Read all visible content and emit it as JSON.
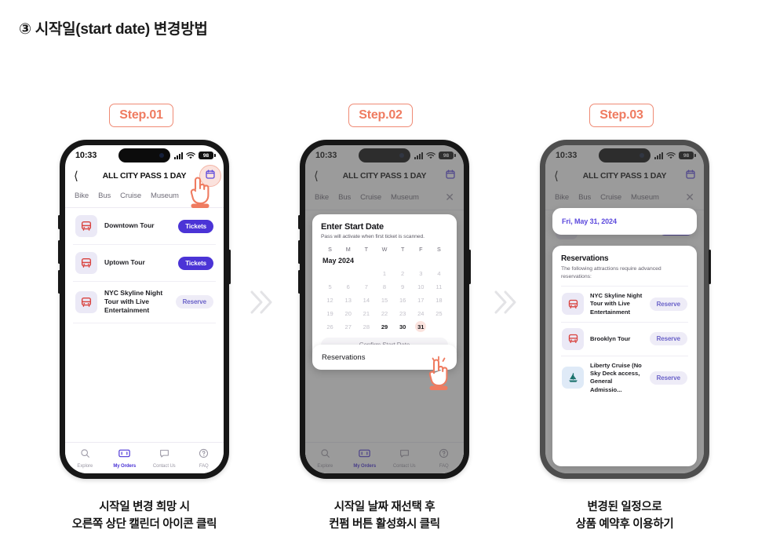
{
  "page": {
    "title": "③ 시작일(start date) 변경방법"
  },
  "steps": [
    {
      "badge": "Step.01",
      "caption_line1": "시작일 변경 희망 시",
      "caption_line2": "오른쪽 상단 캘린더 아이콘 클릭"
    },
    {
      "badge": "Step.02",
      "caption_line1": "시작일 날짜 재선택 후",
      "caption_line2": "컨펌 버튼 활성화시 클릭"
    },
    {
      "badge": "Step.03",
      "caption_line1": "변경된 일정으로",
      "caption_line2": "상품 예약후 이용하기"
    }
  ],
  "status_bar": {
    "time": "10:33",
    "battery": "98",
    "signal_icon": "cellular-bars-icon",
    "wifi_icon": "wifi-icon",
    "battery_icon": "battery-icon"
  },
  "nav": {
    "back_icon": "chevron-left-icon",
    "title": "ALL CITY PASS 1 DAY",
    "calendar_icon": "calendar-icon"
  },
  "category_tabs": {
    "items": [
      "Bike",
      "Bus",
      "Cruise",
      "Museum"
    ],
    "close_icon": "close-x-icon"
  },
  "step1": {
    "rows": [
      {
        "icon": "bus-icon",
        "title": "Downtown Tour",
        "action": "Tickets",
        "style": "solid"
      },
      {
        "icon": "bus-icon",
        "title": "Uptown Tour",
        "action": "Tickets",
        "style": "solid"
      },
      {
        "icon": "bus-icon",
        "title": "NYC Skyline Night Tour with Live Entertainment",
        "action": "Reserve",
        "style": "ghost"
      }
    ]
  },
  "step2": {
    "modal": {
      "title": "Enter Start Date",
      "subtitle": "Pass will activate when first ticket is scanned.",
      "weekdays": [
        "S",
        "M",
        "T",
        "W",
        "T",
        "F",
        "S"
      ],
      "month": "May 2024",
      "lead_blanks": 3,
      "days": [
        {
          "n": "1",
          "state": "disabled"
        },
        {
          "n": "2",
          "state": "disabled"
        },
        {
          "n": "3",
          "state": "disabled"
        },
        {
          "n": "4",
          "state": "disabled"
        },
        {
          "n": "5",
          "state": "disabled"
        },
        {
          "n": "6",
          "state": "disabled"
        },
        {
          "n": "7",
          "state": "disabled"
        },
        {
          "n": "8",
          "state": "disabled"
        },
        {
          "n": "9",
          "state": "disabled"
        },
        {
          "n": "10",
          "state": "disabled"
        },
        {
          "n": "11",
          "state": "disabled"
        },
        {
          "n": "12",
          "state": "disabled"
        },
        {
          "n": "13",
          "state": "disabled"
        },
        {
          "n": "14",
          "state": "disabled"
        },
        {
          "n": "15",
          "state": "disabled"
        },
        {
          "n": "16",
          "state": "disabled"
        },
        {
          "n": "17",
          "state": "disabled"
        },
        {
          "n": "18",
          "state": "disabled"
        },
        {
          "n": "19",
          "state": "disabled"
        },
        {
          "n": "20",
          "state": "disabled"
        },
        {
          "n": "21",
          "state": "disabled"
        },
        {
          "n": "22",
          "state": "disabled"
        },
        {
          "n": "23",
          "state": "disabled"
        },
        {
          "n": "24",
          "state": "disabled"
        },
        {
          "n": "25",
          "state": "disabled"
        },
        {
          "n": "26",
          "state": "disabled"
        },
        {
          "n": "27",
          "state": "disabled"
        },
        {
          "n": "28",
          "state": "disabled"
        },
        {
          "n": "29",
          "state": "available"
        },
        {
          "n": "30",
          "state": "available"
        },
        {
          "n": "31",
          "state": "selected"
        }
      ],
      "confirm_label": "Confirm Start Date"
    },
    "reservations_label": "Reservations"
  },
  "step3": {
    "selected_date": "Fri, May 31, 2024",
    "reservations": {
      "heading": "Reservations",
      "subtitle": "The following attractions require advanced reservations:",
      "rows": [
        {
          "icon": "bus-icon",
          "title": "NYC Skyline Night Tour with Live Entertainment",
          "action": "Reserve"
        },
        {
          "icon": "bus-icon",
          "title": "Brooklyn Tour",
          "action": "Reserve"
        },
        {
          "icon": "boat-icon",
          "title": "Liberty Cruise (No Sky Deck access, General Admissio...",
          "action": "Reserve"
        }
      ]
    }
  },
  "tab_bar": {
    "items": [
      {
        "icon": "search-icon",
        "label": "Explore",
        "active": false
      },
      {
        "icon": "ticket-icon",
        "label": "My Orders",
        "active": true
      },
      {
        "icon": "chat-icon",
        "label": "Contact Us",
        "active": false
      },
      {
        "icon": "help-icon",
        "label": "FAQ",
        "active": false
      }
    ]
  },
  "colors": {
    "accent_purple": "#4b34d6",
    "badge_coral": "#ef7b60",
    "selected_day_bg": "#fbe3de",
    "hand_coral": "#ef7b60"
  }
}
